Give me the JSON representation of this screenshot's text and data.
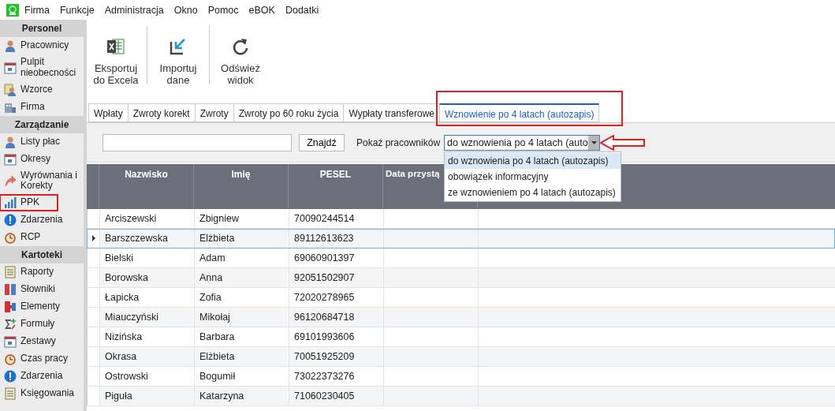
{
  "menu": [
    "Firma",
    "Funkcje",
    "Administracja",
    "Okno",
    "Pomoc",
    "eBOK",
    "Dodatki"
  ],
  "sidebar": [
    {
      "title": "Personel",
      "items": [
        {
          "label": "Pracownicy",
          "marked": false
        },
        {
          "label": "Pulpit nieobecności",
          "marked": false
        },
        {
          "label": "Wzorce",
          "marked": false
        },
        {
          "label": "Firma",
          "marked": false
        }
      ]
    },
    {
      "title": "Zarządzanie",
      "items": [
        {
          "label": "Listy płac",
          "marked": false
        },
        {
          "label": "Okresy",
          "marked": false
        },
        {
          "label": "Wyrównania i Korekty",
          "marked": false
        },
        {
          "label": "PPK",
          "marked": true
        },
        {
          "label": "Zdarzenia",
          "marked": false
        },
        {
          "label": "RCP",
          "marked": false
        }
      ]
    },
    {
      "title": "Kartoteki",
      "items": [
        {
          "label": "Raporty",
          "marked": false
        },
        {
          "label": "Słowniki",
          "marked": false
        },
        {
          "label": "Elementy",
          "marked": false
        },
        {
          "label": "Formuły",
          "marked": false
        },
        {
          "label": "Zestawy",
          "marked": false
        },
        {
          "label": "Czas pracy",
          "marked": false
        },
        {
          "label": "Zdarzenia",
          "marked": false
        },
        {
          "label": "Księgowania",
          "marked": false
        }
      ]
    }
  ],
  "toolbar": [
    {
      "kind": "excel",
      "label": "Eksportuj do Excela"
    },
    {
      "kind": "import",
      "label": "Importuj dane"
    },
    {
      "kind": "refresh",
      "label": "Odśwież widok"
    }
  ],
  "tabs": [
    {
      "label": "Wpłaty",
      "selected": false,
      "marked": false
    },
    {
      "label": "Zwroty korekt",
      "selected": false,
      "marked": false
    },
    {
      "label": "Zwroty",
      "selected": false,
      "marked": false
    },
    {
      "label": "Zwroty po 60 roku życia",
      "selected": false,
      "marked": false
    },
    {
      "label": "Wypłaty transferowe",
      "selected": false,
      "marked": false
    },
    {
      "label": "Wznowienie po 4 latach (autozapis)",
      "selected": true,
      "marked": true
    }
  ],
  "filter": {
    "find_button": "Znajdź",
    "show_label": "Pokaż pracowników",
    "combo_value": "do wznowienia po 4 latach (auto",
    "arrow_marked": true,
    "options": [
      {
        "label": "do wznowienia po 4 latach (autozapis)",
        "selected": true
      },
      {
        "label": "obowiązek informacyjny",
        "selected": false
      },
      {
        "label": "ze wznowieniem po 4 latach (autozapis)",
        "selected": false
      }
    ]
  },
  "table": {
    "columns": [
      "Nazwisko",
      "Imię",
      "PESEL",
      "Data przystą"
    ],
    "rows": [
      {
        "cells": [
          "Arciszewski",
          "Zbigniew",
          "70090244514"
        ],
        "selected": false
      },
      {
        "cells": [
          "Barszczewska",
          "Elżbieta",
          "89112613623"
        ],
        "selected": true
      },
      {
        "cells": [
          "Bielski",
          "Adam",
          "69060901397"
        ],
        "selected": false
      },
      {
        "cells": [
          "Borowska",
          "Anna",
          "92051502907"
        ],
        "selected": false
      },
      {
        "cells": [
          "Łapicka",
          "Zofia",
          "72020278965"
        ],
        "selected": false
      },
      {
        "cells": [
          "Miauczyński",
          "Mikołaj",
          "96120684718"
        ],
        "selected": false
      },
      {
        "cells": [
          "Nizińska",
          "Barbara",
          "69101993606"
        ],
        "selected": false
      },
      {
        "cells": [
          "Okrasa",
          "Elżbieta",
          "70051925209"
        ],
        "selected": false
      },
      {
        "cells": [
          "Ostrowski",
          "Bogumił",
          "73022373276"
        ],
        "selected": false
      },
      {
        "cells": [
          "Piguła",
          "Katarzyna",
          "71060230405"
        ],
        "selected": false
      }
    ]
  }
}
